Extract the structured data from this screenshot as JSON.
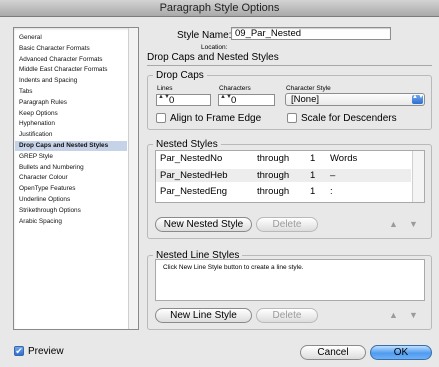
{
  "window": {
    "title": "Paragraph Style Options"
  },
  "sidebar": {
    "items": [
      {
        "label": "General",
        "selected": false
      },
      {
        "label": "Basic Character Formats",
        "selected": false
      },
      {
        "label": "Advanced Character Formats",
        "selected": false
      },
      {
        "label": "Middle East Character Formats",
        "selected": false
      },
      {
        "label": "Indents and Spacing",
        "selected": false
      },
      {
        "label": "Tabs",
        "selected": false
      },
      {
        "label": "Paragraph Rules",
        "selected": false
      },
      {
        "label": "Keep Options",
        "selected": false
      },
      {
        "label": "Hyphenation",
        "selected": false
      },
      {
        "label": "Justification",
        "selected": false
      },
      {
        "label": "Drop Caps and Nested Styles",
        "selected": true
      },
      {
        "label": "GREP Style",
        "selected": false
      },
      {
        "label": "Bullets and Numbering",
        "selected": false
      },
      {
        "label": "Character Colour",
        "selected": false
      },
      {
        "label": "OpenType Features",
        "selected": false
      },
      {
        "label": "Underline Options",
        "selected": false
      },
      {
        "label": "Strikethrough Options",
        "selected": false
      },
      {
        "label": "Arabic Spacing",
        "selected": false
      }
    ]
  },
  "header": {
    "style_name_label": "Style Name:",
    "style_name_value": "09_Par_Nested",
    "location_label": "Location:",
    "section_title": "Drop Caps and Nested Styles"
  },
  "drop_caps": {
    "legend": "Drop Caps",
    "lines_label": "Lines",
    "lines_value": "0",
    "characters_label": "Characters",
    "characters_value": "0",
    "character_style_label": "Character Style",
    "character_style_value": "[None]",
    "align_label": "Align to Frame Edge",
    "scale_label": "Scale for Descenders"
  },
  "nested_styles": {
    "legend": "Nested Styles",
    "rows": [
      {
        "style": "Par_NestedNo",
        "through": "through",
        "count": "1",
        "until": "Words"
      },
      {
        "style": "Par_NestedHeb",
        "through": "through",
        "count": "1",
        "until": "–"
      },
      {
        "style": "Par_NestedEng",
        "through": "through",
        "count": "1",
        "until": ":"
      }
    ],
    "new_button": "New Nested Style",
    "delete_button": "Delete"
  },
  "nested_line_styles": {
    "legend": "Nested Line Styles",
    "hint": "Click New Line Style button to create a line style.",
    "new_button": "New Line Style",
    "delete_button": "Delete"
  },
  "footer": {
    "preview_label": "Preview",
    "preview_checked": true,
    "cancel_button": "Cancel",
    "ok_button": "OK"
  },
  "icons": {
    "up": "▲",
    "down": "▼",
    "check": "✔",
    "stepper": "▲▼",
    "select": "▲▼"
  }
}
